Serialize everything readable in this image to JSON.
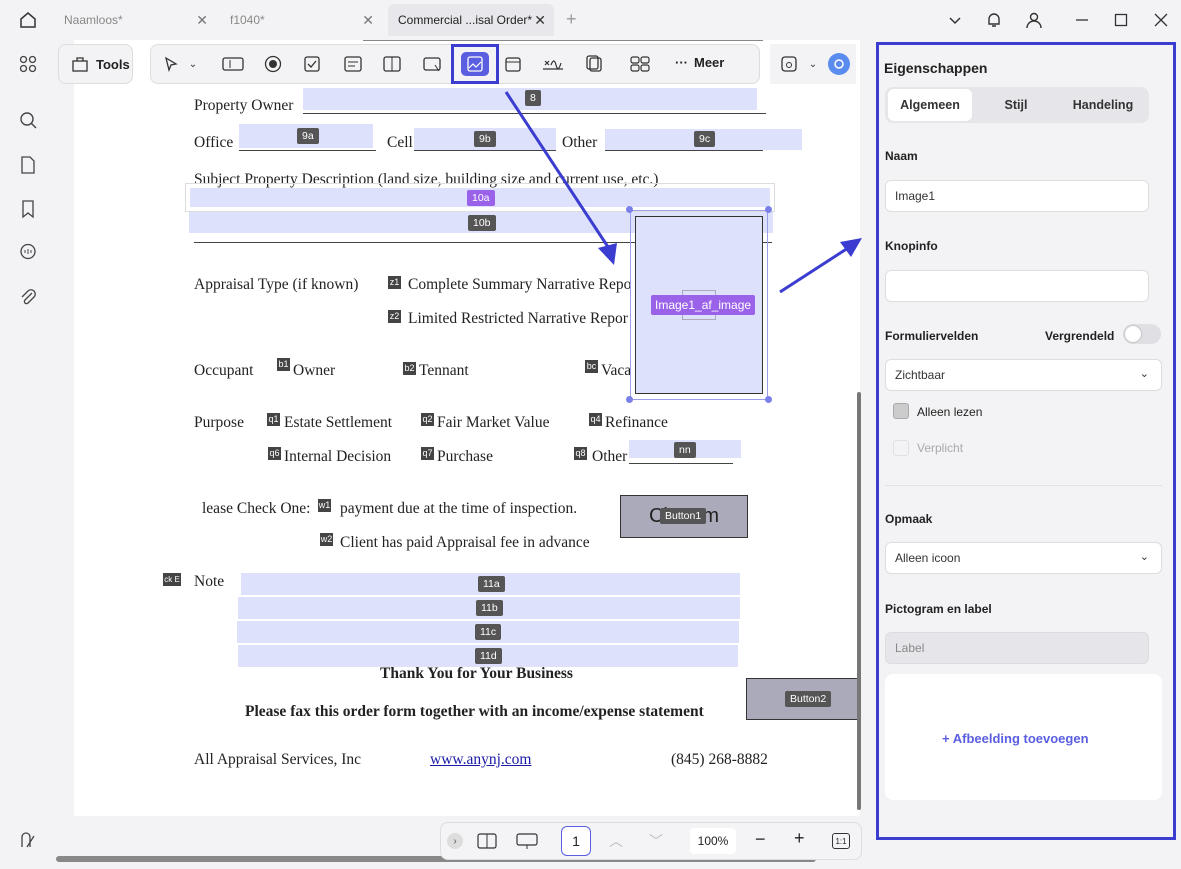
{
  "tabs": [
    {
      "label": "Naamloos*"
    },
    {
      "label": "f1040*"
    },
    {
      "label": "Commercial ...isal Order*"
    }
  ],
  "toolbar": {
    "tools_label": "Tools",
    "more_label": "Meer"
  },
  "document": {
    "property_owner": "Property Owner",
    "office": "Office",
    "cell": "Cell",
    "other": "Other",
    "subject_desc": "Subject Property Description (land size, building size and current use, etc.)",
    "appraisal_type": "Appraisal Type (if known)",
    "complete_summary": "Complete Summary Narrative Repo",
    "limited_restricted": "Limited Restricted Narrative Repor",
    "occupant": "Occupant",
    "owner": "Owner",
    "tennant": "Tennant",
    "vacant": "Vaca",
    "purpose": "Purpose",
    "estate": "Estate Settlement",
    "fmv": "Fair Market Value",
    "refinance": "Refinance",
    "internal": "Internal Decision",
    "purchase": "Purchase",
    "other2": "Other",
    "please_check": "lease Check One:",
    "payment_due": "payment due at the time of inspection.",
    "client_paid": "Client has paid Appraisal fee in advance",
    "clear_form": "Cle   orm",
    "note": "Note",
    "ck": "ck E",
    "thank_you": "Thank You for Your Business",
    "fax": "Please fax this order form together with an income/expense statement",
    "company": "All Appraisal Services, Inc",
    "website": "www.anynj.com",
    "phone": "(845) 268-8882"
  },
  "field_tags": {
    "f8": "8",
    "f9a": "9a",
    "f9b": "9b",
    "f9c": "9c",
    "f10a": "10a",
    "f10b": "10b",
    "fz1": "z1",
    "fz2": "z2",
    "fb1": "b1",
    "fb2": "b2",
    "fbc": "bc",
    "fq1": "q1",
    "fq2": "q2",
    "fq4": "q4",
    "fq6": "q6",
    "fq7": "q7",
    "fq8": "q8",
    "fnn": "nn",
    "fw1": "w1",
    "fw2": "w2",
    "f11a": "11a",
    "f11b": "11b",
    "f11c": "11c",
    "f11d": "11d",
    "image": "Image1_af_image",
    "button1": "Button1",
    "button2": "Button2"
  },
  "bottombar": {
    "page": "1",
    "zoom": "100%"
  },
  "panel": {
    "title": "Eigenschappen",
    "tabs": [
      "Algemeen",
      "Stijl",
      "Handeling"
    ],
    "name_label": "Naam",
    "name_value": "Image1",
    "tooltip_label": "Knopinfo",
    "tooltip_value": "",
    "form_fields_label": "Formuliervelden",
    "locked_label": "Vergrendeld",
    "visibility": "Zichtbaar",
    "readonly": "Alleen lezen",
    "required": "Verplicht",
    "layout_label": "Opmaak",
    "layout_value": "Alleen icoon",
    "icon_label_title": "Pictogram en label",
    "label_placeholder": "Label",
    "add_image": "+ Afbeelding toevoegen"
  },
  "colors": {
    "accent": "#3a3dd0",
    "field": "#dde1fb",
    "purple_tag": "#9a62e8"
  }
}
